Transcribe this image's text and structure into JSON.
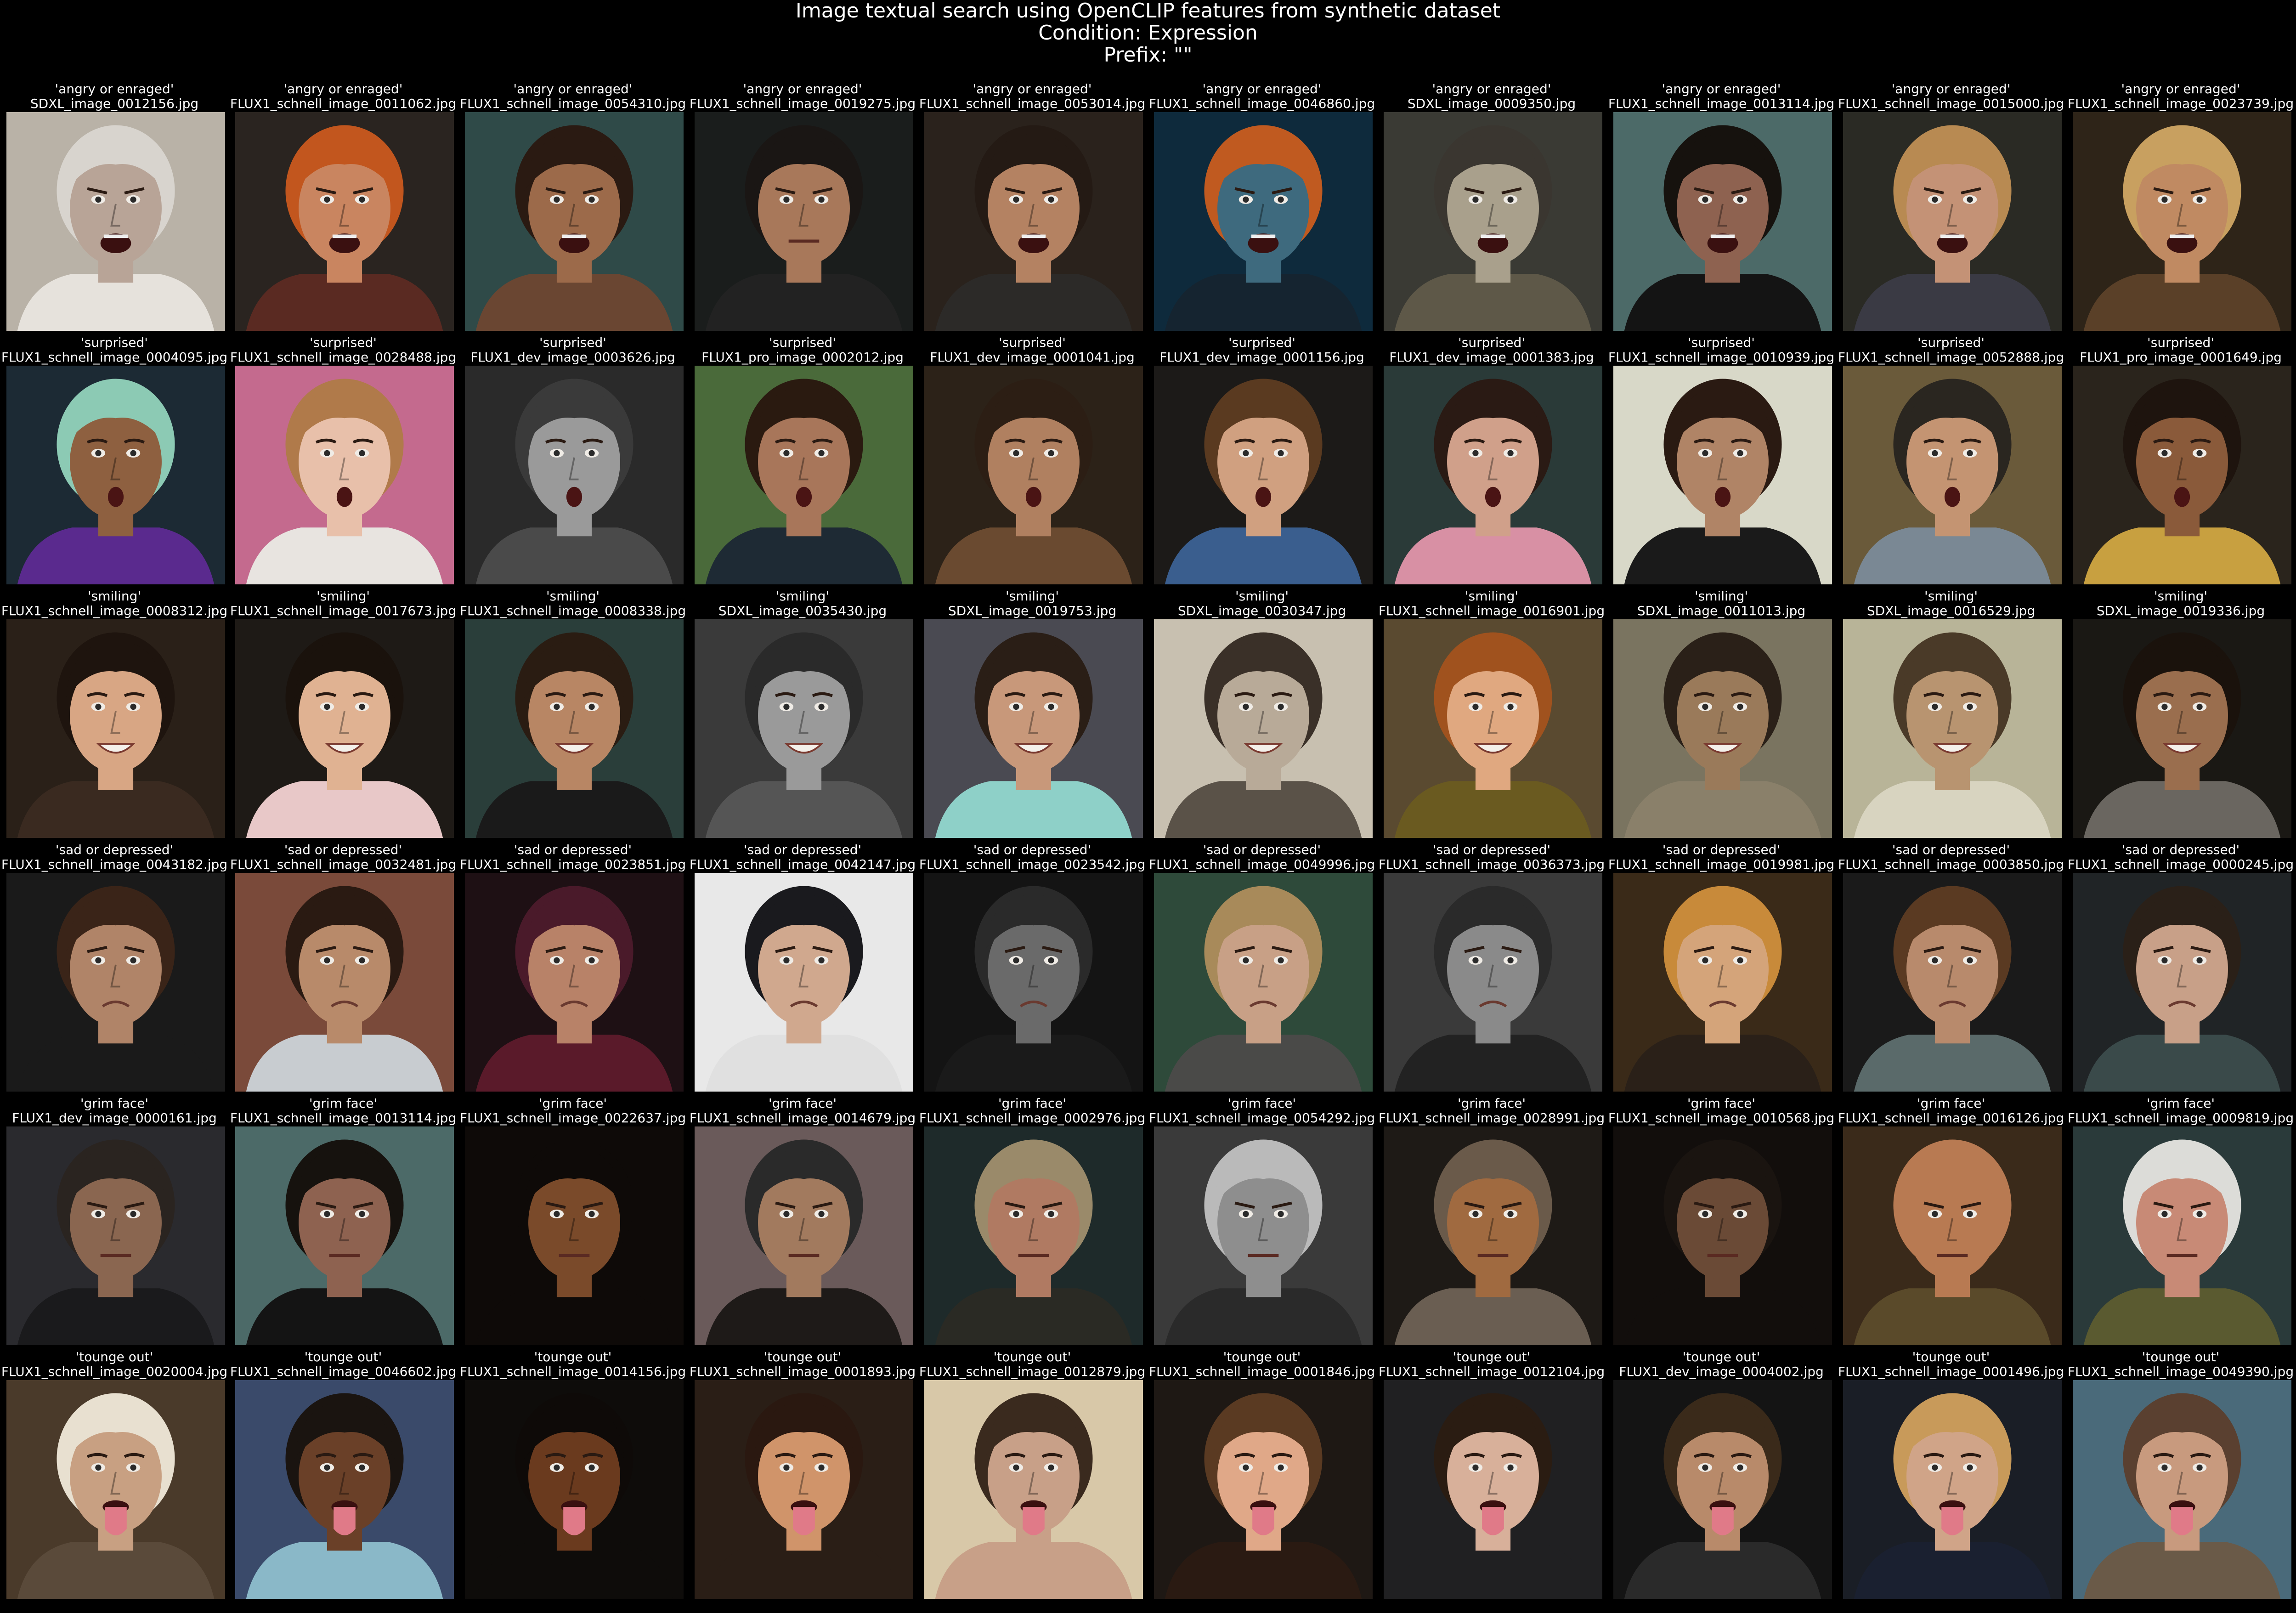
{
  "title": {
    "line1": "Image textual search using OpenCLIP features from synthetic dataset",
    "line2": "Condition: Expression",
    "line3": "Prefix: \"\""
  },
  "rows": [
    {
      "query": "'angry or enraged'",
      "cells": [
        {
          "file": "SDXL_image_0012156.jpg",
          "bg": "#b9b2a7",
          "skin": "#b8a497",
          "hair": "#d8d4ce",
          "shirt": "#e6e2dc",
          "mouth": "open"
        },
        {
          "file": "FLUX1_schnell_image_0011062.jpg",
          "bg": "#2a2420",
          "skin": "#c98560",
          "hair": "#c2561e",
          "shirt": "#5a2a22",
          "mouth": "open"
        },
        {
          "file": "FLUX1_schnell_image_0054310.jpg",
          "bg": "#2f4a48",
          "skin": "#9c6a4a",
          "hair": "#2a1a12",
          "shirt": "#6a4632",
          "mouth": "open"
        },
        {
          "file": "FLUX1_schnell_image_0019275.jpg",
          "bg": "#1a1d1c",
          "skin": "#a8785a",
          "hair": "#1a1614",
          "shirt": "#222",
          "mouth": "grim"
        },
        {
          "file": "FLUX1_schnell_image_0053014.jpg",
          "bg": "#2a221c",
          "skin": "#b48262",
          "hair": "#241a14",
          "shirt": "#2c2a28",
          "mouth": "open"
        },
        {
          "file": "FLUX1_schnell_image_0046860.jpg",
          "bg": "#0e2a3c",
          "skin": "#3e6a7e",
          "hair": "#c05a20",
          "shirt": "#152430",
          "mouth": "open"
        },
        {
          "file": "SDXL_image_0009350.jpg",
          "bg": "#3a3a34",
          "skin": "#a9a08c",
          "hair": "#3a3630",
          "shirt": "#5e5848",
          "mouth": "open"
        },
        {
          "file": "FLUX1_schnell_image_0013114.jpg",
          "bg": "#4c6a68",
          "skin": "#8e6250",
          "hair": "#16120e",
          "shirt": "#141414",
          "mouth": "open"
        },
        {
          "file": "FLUX1_schnell_image_0015000.jpg",
          "bg": "#2a2a24",
          "skin": "#c49276",
          "hair": "#b88a52",
          "shirt": "#3a3a44",
          "mouth": "open"
        },
        {
          "file": "FLUX1_schnell_image_0023739.jpg",
          "bg": "#2e2418",
          "skin": "#c08a62",
          "hair": "#c8a060",
          "shirt": "#5a4028",
          "mouth": "open"
        }
      ]
    },
    {
      "query": "'surprised'",
      "cells": [
        {
          "file": "FLUX1_schnell_image_0004095.jpg",
          "bg": "#1c2a34",
          "skin": "#8e6040",
          "hair": "#8ccab4",
          "shirt": "#5a2a8e",
          "mouth": "oh"
        },
        {
          "file": "FLUX1_schnell_image_0028488.jpg",
          "bg": "#c46a8e",
          "skin": "#e8c0aa",
          "hair": "#b07a4a",
          "shirt": "#e8e4e0",
          "mouth": "oh"
        },
        {
          "file": "FLUX1_dev_image_0003626.jpg",
          "bg": "#2a2a2a",
          "skin": "#9a9a9a",
          "hair": "#3a3a3a",
          "shirt": "#4a4a4a",
          "mouth": "oh"
        },
        {
          "file": "FLUX1_pro_image_0002012.jpg",
          "bg": "#4a6a3a",
          "skin": "#a8765a",
          "hair": "#2a1a10",
          "shirt": "#1e2a34",
          "mouth": "oh"
        },
        {
          "file": "FLUX1_dev_image_0001041.jpg",
          "bg": "#2c2218",
          "skin": "#b08060",
          "hair": "#2c1e14",
          "shirt": "#6a4a30",
          "mouth": "oh"
        },
        {
          "file": "FLUX1_dev_image_0001156.jpg",
          "bg": "#1c1a18",
          "skin": "#d0a080",
          "hair": "#5a3a20",
          "shirt": "#3a5e8e",
          "mouth": "oh"
        },
        {
          "file": "FLUX1_dev_image_0001383.jpg",
          "bg": "#2a3a38",
          "skin": "#d0a08a",
          "hair": "#2a1a14",
          "shirt": "#d890a4",
          "mouth": "oh"
        },
        {
          "file": "FLUX1_schnell_image_0010939.jpg",
          "bg": "#d8d8c8",
          "skin": "#b08466",
          "hair": "#2a1a12",
          "shirt": "#1a1a1a",
          "mouth": "oh"
        },
        {
          "file": "FLUX1_schnell_image_0052888.jpg",
          "bg": "#6a5a3a",
          "skin": "#c49472",
          "hair": "#2a2620",
          "shirt": "#7a8894",
          "mouth": "oh"
        },
        {
          "file": "FLUX1_pro_image_0001649.jpg",
          "bg": "#2a241c",
          "skin": "#8a5a3a",
          "hair": "#1e140e",
          "shirt": "#c8a040",
          "mouth": "oh"
        }
      ]
    },
    {
      "query": "'smiling'",
      "cells": [
        {
          "file": "FLUX1_schnell_image_0008312.jpg",
          "bg": "#2a2018",
          "skin": "#d8a684",
          "hair": "#1e140e",
          "shirt": "#3a2a20",
          "mouth": "smile"
        },
        {
          "file": "FLUX1_schnell_image_0017673.jpg",
          "bg": "#1e1a16",
          "skin": "#e0b292",
          "hair": "#1a120c",
          "shirt": "#e8c8c8",
          "mouth": "smile"
        },
        {
          "file": "FLUX1_schnell_image_0008338.jpg",
          "bg": "#2a3e3a",
          "skin": "#b88664",
          "hair": "#2a1c12",
          "shirt": "#1a1a1a",
          "mouth": "smile"
        },
        {
          "file": "SDXL_image_0035430.jpg",
          "bg": "#3a3a3a",
          "skin": "#9a9a9a",
          "hair": "#2a2a2a",
          "shirt": "#555",
          "mouth": "smile"
        },
        {
          "file": "SDXL_image_0019753.jpg",
          "bg": "#4a4a52",
          "skin": "#c8987a",
          "hair": "#2a1e16",
          "shirt": "#8ed0c8",
          "mouth": "smile"
        },
        {
          "file": "SDXL_image_0030347.jpg",
          "bg": "#c8c0b0",
          "skin": "#b8aa98",
          "hair": "#3a3028",
          "shirt": "#5a5248",
          "mouth": "smile"
        },
        {
          "file": "FLUX1_schnell_image_0016901.jpg",
          "bg": "#5a4a30",
          "skin": "#e0a880",
          "hair": "#a0521e",
          "shirt": "#6a5a20",
          "mouth": "smile"
        },
        {
          "file": "SDXL_image_0011013.jpg",
          "bg": "#7a7460",
          "skin": "#9a7a5a",
          "hair": "#2a2018",
          "shirt": "#8a806a",
          "mouth": "smile"
        },
        {
          "file": "SDXL_image_0016529.jpg",
          "bg": "#b8b498",
          "skin": "#b89470",
          "hair": "#4a3a28",
          "shirt": "#d8d4c0",
          "mouth": "smile"
        },
        {
          "file": "SDXL_image_0019336.jpg",
          "bg": "#1a1814",
          "skin": "#9a6e4e",
          "hair": "#1a120c",
          "shirt": "#6a6660",
          "mouth": "smile"
        }
      ]
    },
    {
      "query": "'sad or depressed'",
      "cells": [
        {
          "file": "FLUX1_schnell_image_0043182.jpg",
          "bg": "#1a1a1a",
          "skin": "#b08468",
          "hair": "#3a2418",
          "shirt": "#1a1a1a",
          "mouth": "sad"
        },
        {
          "file": "FLUX1_schnell_image_0032481.jpg",
          "bg": "#7a4a3a",
          "skin": "#b88a6a",
          "hair": "#2a1a12",
          "shirt": "#c8ccd0",
          "mouth": "sad"
        },
        {
          "file": "FLUX1_schnell_image_0023851.jpg",
          "bg": "#1e1014",
          "skin": "#b88268",
          "hair": "#4a1a2a",
          "shirt": "#5a1a2a",
          "mouth": "sad"
        },
        {
          "file": "FLUX1_schnell_image_0042147.jpg",
          "bg": "#e8e8e8",
          "skin": "#d0a88e",
          "hair": "#1a1a1e",
          "shirt": "#e0e0e0",
          "mouth": "sad"
        },
        {
          "file": "FLUX1_schnell_image_0023542.jpg",
          "bg": "#141414",
          "skin": "#6a6a6a",
          "hair": "#2a2a2a",
          "shirt": "#1a1a1a",
          "mouth": "sad"
        },
        {
          "file": "FLUX1_schnell_image_0049996.jpg",
          "bg": "#2e4a3a",
          "skin": "#c8a086",
          "hair": "#a88a5a",
          "shirt": "#4a4a48",
          "mouth": "sad"
        },
        {
          "file": "FLUX1_schnell_image_0036373.jpg",
          "bg": "#3a3a3a",
          "skin": "#8a8a8a",
          "hair": "#2a2a2a",
          "shirt": "#222",
          "mouth": "sad"
        },
        {
          "file": "FLUX1_schnell_image_0019981.jpg",
          "bg": "#3a2a18",
          "skin": "#d4a47a",
          "hair": "#c88a3a",
          "shirt": "#2a2018",
          "mouth": "sad"
        },
        {
          "file": "FLUX1_schnell_image_0003850.jpg",
          "bg": "#1a1a1a",
          "skin": "#b88a6c",
          "hair": "#5a3a22",
          "shirt": "#5a6a6a",
          "mouth": "sad"
        },
        {
          "file": "FLUX1_schnell_image_0000245.jpg",
          "bg": "#202426",
          "skin": "#c8a088",
          "hair": "#2a2018",
          "shirt": "#3a4a4a",
          "mouth": "sad"
        }
      ]
    },
    {
      "query": "'grim face'",
      "cells": [
        {
          "file": "FLUX1_dev_image_0000161.jpg",
          "bg": "#2a2a2e",
          "skin": "#8a6650",
          "hair": "#2a2420",
          "shirt": "#1a1a1c",
          "mouth": "grim"
        },
        {
          "file": "FLUX1_schnell_image_0013114.jpg",
          "bg": "#4c6a68",
          "skin": "#8e6250",
          "hair": "#16120e",
          "shirt": "#141414",
          "mouth": "grim"
        },
        {
          "file": "FLUX1_schnell_image_0022637.jpg",
          "bg": "#0e0a08",
          "skin": "#7a4a2a",
          "hair": "#0e0a08",
          "shirt": "#0e0a08",
          "mouth": "grim"
        },
        {
          "file": "FLUX1_schnell_image_0014679.jpg",
          "bg": "#6a5a5a",
          "skin": "#a27a5e",
          "hair": "#2a2a2a",
          "shirt": "#1e1a18",
          "mouth": "grim"
        },
        {
          "file": "FLUX1_schnell_image_0002976.jpg",
          "bg": "#1e2a2a",
          "skin": "#b07a62",
          "hair": "#9a8a6a",
          "shirt": "#2a2a24",
          "mouth": "grim"
        },
        {
          "file": "FLUX1_schnell_image_0054292.jpg",
          "bg": "#3a3a3a",
          "skin": "#8e8e8e",
          "hair": "#bababa",
          "shirt": "#2a2a2a",
          "mouth": "grim"
        },
        {
          "file": "FLUX1_schnell_image_0028991.jpg",
          "bg": "#1e1a16",
          "skin": "#a06a40",
          "hair": "#6a5a4a",
          "shirt": "#6a5e52",
          "mouth": "grim"
        },
        {
          "file": "FLUX1_schnell_image_0010568.jpg",
          "bg": "#120e0c",
          "skin": "#6a4a36",
          "hair": "#1a1410",
          "shirt": "#120e0c",
          "mouth": "grim"
        },
        {
          "file": "FLUX1_schnell_image_0016126.jpg",
          "bg": "#3a2a1a",
          "skin": "#b87a52",
          "hair": "#b87a52",
          "shirt": "#5a4a2a",
          "mouth": "grim"
        },
        {
          "file": "FLUX1_schnell_image_0009819.jpg",
          "bg": "#2a3a3a",
          "skin": "#c88a76",
          "hair": "#dcdcd8",
          "shirt": "#5a5a30",
          "mouth": "grim"
        }
      ]
    },
    {
      "query": "'tounge out'",
      "cells": [
        {
          "file": "FLUX1_schnell_image_0020004.jpg",
          "bg": "#4a3a2a",
          "skin": "#c8a082",
          "hair": "#e8e0d0",
          "shirt": "#5a4a3a",
          "mouth": "tongue"
        },
        {
          "file": "FLUX1_schnell_image_0046602.jpg",
          "bg": "#3a4a6a",
          "skin": "#6a4028",
          "hair": "#1a1410",
          "shirt": "#8ab8c8",
          "mouth": "tongue"
        },
        {
          "file": "FLUX1_schnell_image_0014156.jpg",
          "bg": "#0e0c0a",
          "skin": "#6a3a1e",
          "hair": "#0e0a08",
          "shirt": "#0e0c0a",
          "mouth": "tongue"
        },
        {
          "file": "FLUX1_schnell_image_0001893.jpg",
          "bg": "#2a1e16",
          "skin": "#d0946a",
          "hair": "#2a1810",
          "shirt": "#2a1e16",
          "mouth": "tongue"
        },
        {
          "file": "FLUX1_schnell_image_0012879.jpg",
          "bg": "#d8c8a8",
          "skin": "#c8a088",
          "hair": "#3a2a1e",
          "shirt": "#c8a088",
          "mouth": "tongue"
        },
        {
          "file": "FLUX1_schnell_image_0001846.jpg",
          "bg": "#1e1814",
          "skin": "#e0a888",
          "hair": "#5a3a22",
          "shirt": "#2a1a12",
          "mouth": "tongue"
        },
        {
          "file": "FLUX1_schnell_image_0012104.jpg",
          "bg": "#202022",
          "skin": "#d8b09a",
          "hair": "#2a1c12",
          "shirt": "#202022",
          "mouth": "tongue"
        },
        {
          "file": "FLUX1_dev_image_0004002.jpg",
          "bg": "#141414",
          "skin": "#b88a6a",
          "hair": "#3a2a1a",
          "shirt": "#2a2a2a",
          "mouth": "tongue"
        },
        {
          "file": "FLUX1_schnell_image_0001496.jpg",
          "bg": "#1a1e26",
          "skin": "#d0a488",
          "hair": "#c89a5a",
          "shirt": "#1a2030",
          "mouth": "tongue"
        },
        {
          "file": "FLUX1_schnell_image_0049390.jpg",
          "bg": "#4a6a7a",
          "skin": "#c89a7e",
          "hair": "#5a4030",
          "shirt": "#6a5a48",
          "mouth": "tongue"
        }
      ]
    }
  ]
}
